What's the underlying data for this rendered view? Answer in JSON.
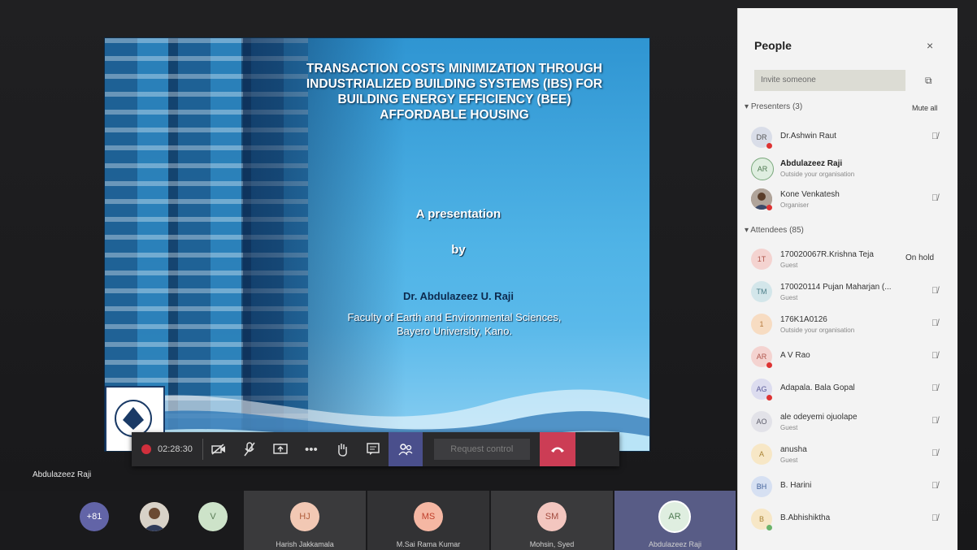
{
  "slide": {
    "title_lines": [
      "TRANSACTION COSTS MINIMIZATION THROUGH",
      "INDUSTRIALIZED BUILDING SYSTEMS (IBS) FOR",
      "BUILDING ENERGY EFFICIENCY (BEE)",
      "AFFORDABLE HOUSING"
    ],
    "subtitle": "A presentation",
    "by": "by",
    "author": "Dr. Abdulazeez U. Raji",
    "affiliation_lines": [
      "Faculty of Earth and Environmental Sciences,",
      "Bayero University, Kano."
    ]
  },
  "controls": {
    "timer": "02:28:30",
    "request_control": "Request control",
    "icons": [
      "record-icon",
      "video-off-icon",
      "mic-off-icon",
      "share-screen-icon",
      "more-icon",
      "raise-hand-icon",
      "chat-icon",
      "people-icon",
      "hang-up-icon"
    ]
  },
  "speaker": {
    "name": "Abdulazeez Raji"
  },
  "strip": {
    "overflow": "+81",
    "tiles": [
      {
        "initials": "V",
        "name": ""
      },
      {
        "initials": "HJ",
        "name": "Harish Jakkamala"
      },
      {
        "initials": "MS",
        "name": "M.Sai Rama Kumar"
      },
      {
        "initials": "SM",
        "name": "Mohsin, Syed"
      },
      {
        "initials": "AR",
        "name": "Abdulazeez Raji"
      }
    ]
  },
  "panel": {
    "title": "People",
    "close": "×",
    "invite_placeholder": "Invite someone",
    "presenters_label": "Presenters (3)",
    "mute_all": "Mute all",
    "attendees_label": "Attendees (85)",
    "presenters": [
      {
        "initials": "DR",
        "name": "Dr.Ashwin Raut",
        "sub": ""
      },
      {
        "initials": "AR",
        "name": "Abdulazeez Raji",
        "sub": "Outside your organisation"
      },
      {
        "initials": "",
        "name": "Kone Venkatesh",
        "sub": "Organiser"
      }
    ],
    "attendees": [
      {
        "initials": "1T",
        "name": "170020067R.Krishna Teja",
        "sub": "Guest",
        "status": "On hold"
      },
      {
        "initials": "TM",
        "name": "170020114 Pujan Maharjan (...",
        "sub": "Guest",
        "status": ""
      },
      {
        "initials": "1",
        "name": "176K1A0126",
        "sub": "Outside your organisation",
        "status": ""
      },
      {
        "initials": "AR",
        "name": "A V Rao",
        "sub": "",
        "status": ""
      },
      {
        "initials": "AG",
        "name": "Adapala. Bala Gopal",
        "sub": "",
        "status": ""
      },
      {
        "initials": "AO",
        "name": "ale odeyemi ojuolape",
        "sub": "Guest",
        "status": ""
      },
      {
        "initials": "A",
        "name": "anusha",
        "sub": "Guest",
        "status": ""
      },
      {
        "initials": "BH",
        "name": "B. Harini",
        "sub": "",
        "status": ""
      },
      {
        "initials": "B",
        "name": "B.Abhishiktha",
        "sub": "",
        "status": ""
      }
    ]
  }
}
